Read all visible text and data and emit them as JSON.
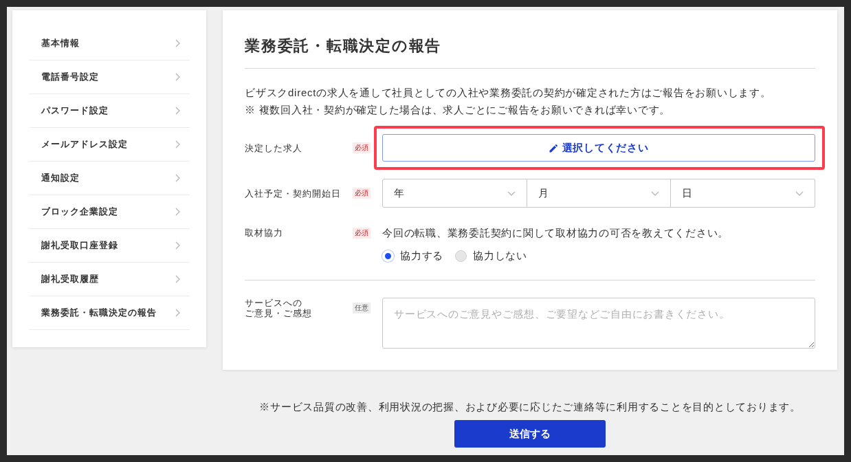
{
  "sidebar": {
    "items": [
      {
        "label": "基本情報"
      },
      {
        "label": "電話番号設定"
      },
      {
        "label": "パスワード設定"
      },
      {
        "label": "メールアドレス設定"
      },
      {
        "label": "通知設定"
      },
      {
        "label": "ブロック企業設定"
      },
      {
        "label": "謝礼受取口座登録"
      },
      {
        "label": "謝礼受取履歴"
      },
      {
        "label": "業務委託・転職決定の報告"
      }
    ]
  },
  "form": {
    "title": "業務委託・転職決定の報告",
    "intro": [
      "ビザスクdirectの求人を通して社員としての入社や業務委託の契約が確定された方はご報告をお願いします。",
      "※ 複数回入社・契約が確定した場合は、求人ごとにご報告をお願いできれば幸いです。"
    ],
    "fields": [
      {
        "kind": "picker",
        "label_lines": [
          "決定した求人"
        ],
        "required": true,
        "badge": "必須",
        "button_label": "選択してください",
        "highlighted": true
      },
      {
        "kind": "date",
        "label_lines": [
          "入社予定・契約開始日"
        ],
        "required": true,
        "badge": "必須",
        "selects": [
          "年",
          "月",
          "日"
        ]
      },
      {
        "kind": "radio",
        "label_lines": [
          "取材協力"
        ],
        "required": true,
        "badge": "必須",
        "question": "今回の転職、業務委託契約に関して取材協力の可否を教えてください。",
        "options": [
          {
            "label": "協力する",
            "selected": true
          },
          {
            "label": "協力しない",
            "selected": false
          }
        ]
      },
      {
        "kind": "textarea",
        "label_lines": [
          "サービスへの",
          "ご意見・ご感想"
        ],
        "required": false,
        "badge": "任意",
        "placeholder": "サービスへのご意見やご感想、ご要望などご自由にお書きください。"
      }
    ]
  },
  "notice": "※サービス品質の改善、利用状況の把握、および必要に応じたご連絡等に利用することを目的としております。",
  "submit_button": "送信する"
}
